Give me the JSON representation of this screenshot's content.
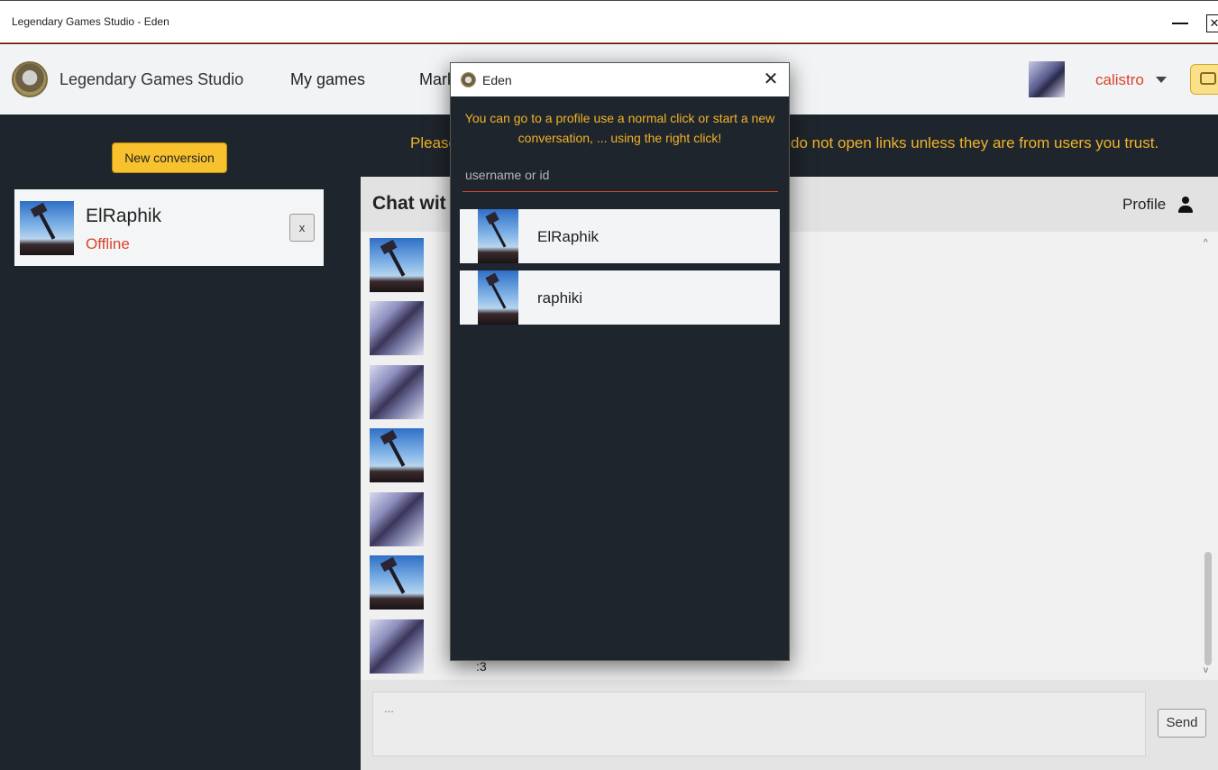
{
  "window": {
    "title": "Legendary Games Studio - Eden",
    "close_glyph": "✕"
  },
  "nav": {
    "brand": "Legendary Games Studio",
    "my_games": "My games",
    "market": "Mark",
    "username": "calistro"
  },
  "left": {
    "new_conversation": "New conversion",
    "conversations": [
      {
        "name": "ElRaphik",
        "status": "Offline",
        "remove": "x"
      }
    ]
  },
  "notice": {
    "left": "Please",
    "right": "do not open links unless they are from users you trust."
  },
  "chat": {
    "title": "Chat wit",
    "profile": "Profile",
    "last_message": ":3",
    "composer_placeholder": "...",
    "send": "Send",
    "scroll_up": "^",
    "scroll_down": "v"
  },
  "dialog": {
    "title": "Eden",
    "close": "✕",
    "hint": "You can go to a profile use a normal click or start a new conversation, ... using the right click!",
    "search_placeholder": "username or id",
    "results": [
      {
        "name": "ElRaphik"
      },
      {
        "name": "raphiki"
      }
    ]
  },
  "colors": {
    "accent": "#f8c12e",
    "danger": "#d9452c",
    "background": "#1f252c"
  }
}
